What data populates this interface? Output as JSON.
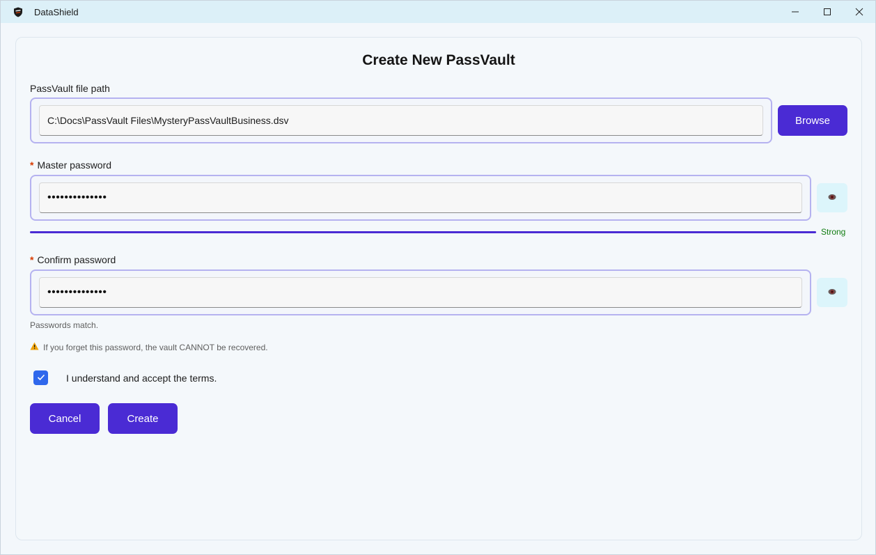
{
  "window": {
    "title": "DataShield",
    "icons": {
      "app": "shield-icon",
      "minimize": "minimize-icon",
      "maximize": "maximize-icon",
      "close": "close-icon"
    }
  },
  "form": {
    "heading": "Create New PassVault",
    "file_path": {
      "label": "PassVault file path",
      "value": "C:\\Docs\\PassVault Files\\MysteryPassVaultBusiness.dsv",
      "browse_label": "Browse"
    },
    "master_password": {
      "required_mark": "*",
      "label": "Master password",
      "masked_value": "••••••••••••••",
      "reveal_icon": "eye-icon",
      "strength_label": "Strong",
      "strength_fraction": 1.0
    },
    "confirm_password": {
      "required_mark": "*",
      "label": "Confirm password",
      "masked_value": "••••••••••••••",
      "reveal_icon": "eye-icon",
      "match_text": "Passwords match."
    },
    "warning": {
      "icon": "warning-icon",
      "text": "If you forget this password, the vault CANNOT be recovered."
    },
    "terms": {
      "checked": true,
      "label": "I understand and accept the terms."
    },
    "buttons": {
      "cancel": "Cancel",
      "create": "Create"
    }
  },
  "colors": {
    "accent": "#4a2bd4",
    "field_border": "#b5b2f0",
    "titlebar": "#dcf0f8",
    "checkbox": "#2f68ec",
    "strength_text": "#107c10",
    "required": "#d83b01"
  }
}
